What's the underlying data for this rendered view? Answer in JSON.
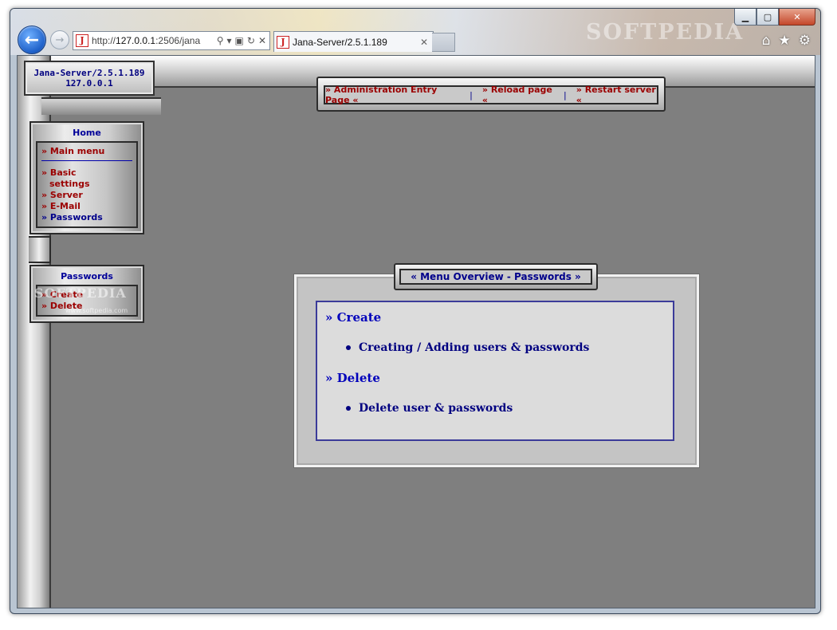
{
  "browser": {
    "address_prefix": "http://",
    "address_host": "127.0.0.1",
    "address_rest": ":2506/jana",
    "tab_title": "Jana-Server/2.5.1.189",
    "watermark": "SOFTPEDIA",
    "win_minimize": "▁",
    "win_maximize": "▢",
    "win_close": "✕"
  },
  "page": {
    "server_name": "Jana-Server/2.5.1.189",
    "server_ip": "127.0.0.1",
    "nav": [
      "» Administration Entry Page «",
      "» Reload page «",
      "» Restart server «"
    ],
    "nav_separator": "|",
    "main_menu": {
      "title": "Home",
      "header_item": "» Main menu",
      "items": [
        "» Basic",
        "settings",
        "» Server",
        "» E-Mail",
        "» Passwords"
      ]
    },
    "sub_menu": {
      "title": "Passwords",
      "items": [
        "» Create",
        "» Delete"
      ]
    },
    "watermark": "SOFTPEDIA",
    "watermark_sub": "www.softpedia.com",
    "panel": {
      "title": "« Menu Overview - Passwords »",
      "sections": [
        {
          "heading": "» Create",
          "bullet": "Creating / Adding users & passwords"
        },
        {
          "heading": "» Delete",
          "bullet": "Delete user & passwords"
        }
      ]
    }
  }
}
